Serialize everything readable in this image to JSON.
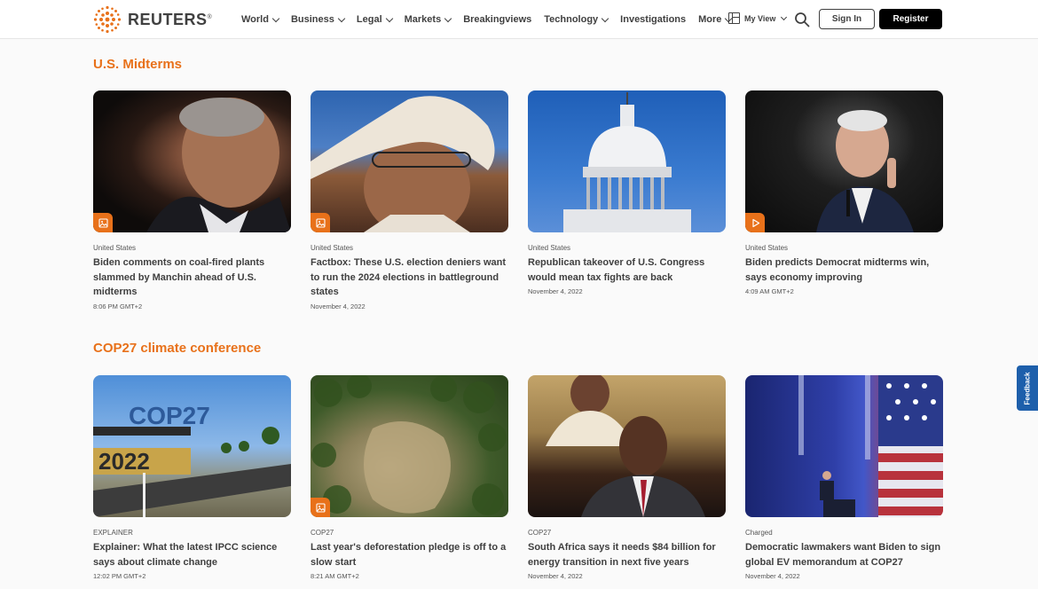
{
  "header": {
    "logo_text": "REUTERS",
    "logo_reg": "®",
    "nav": [
      {
        "label": "World",
        "dropdown": true
      },
      {
        "label": "Business",
        "dropdown": true
      },
      {
        "label": "Legal",
        "dropdown": true
      },
      {
        "label": "Markets",
        "dropdown": true
      },
      {
        "label": "Breakingviews",
        "dropdown": false
      },
      {
        "label": "Technology",
        "dropdown": true
      },
      {
        "label": "Investigations",
        "dropdown": false
      },
      {
        "label": "More",
        "dropdown": true
      }
    ],
    "my_view_label": "My View",
    "sign_in_label": "Sign In",
    "register_label": "Register"
  },
  "sections": [
    {
      "title": "U.S. Midterms",
      "cards": [
        {
          "kicker": "United States",
          "headline": "Biden comments on coal-fired plants slammed by Manchin ahead of U.S. midterms",
          "time": "8:06 PM GMT+2",
          "badge": "image-icon"
        },
        {
          "kicker": "United States",
          "headline": "Factbox: These U.S. election deniers want to run the 2024 elections in battleground states",
          "time": "November 4, 2022",
          "badge": "image-icon"
        },
        {
          "kicker": "United States",
          "headline": "Republican takeover of U.S. Congress would mean tax fights are back",
          "time": "November 4, 2022",
          "badge": ""
        },
        {
          "kicker": "United States",
          "headline": "Biden predicts Democrat midterms win, says economy improving",
          "time": "4:09 AM GMT+2",
          "badge": "play-icon"
        }
      ]
    },
    {
      "title": "COP27 climate conference",
      "cards": [
        {
          "kicker": "EXPLAINER",
          "headline": "Explainer: What the latest IPCC science says about climate change",
          "time": "12:02 PM GMT+2",
          "badge": ""
        },
        {
          "kicker": "COP27",
          "headline": "Last year's deforestation pledge is off to a slow start",
          "time": "8:21 AM GMT+2",
          "badge": "image-icon"
        },
        {
          "kicker": "COP27",
          "headline": "South Africa says it needs $84 billion for energy transition in next five years",
          "time": "November 4, 2022",
          "badge": ""
        },
        {
          "kicker": "Charged",
          "headline": "Democratic lawmakers want Biden to sign global EV memorandum at COP27",
          "time": "November 4, 2022",
          "badge": ""
        }
      ]
    }
  ],
  "feedback_label": "Feedback",
  "colors": {
    "accent": "#e8711a",
    "text": "#404040",
    "feedback": "#1d5fab"
  }
}
